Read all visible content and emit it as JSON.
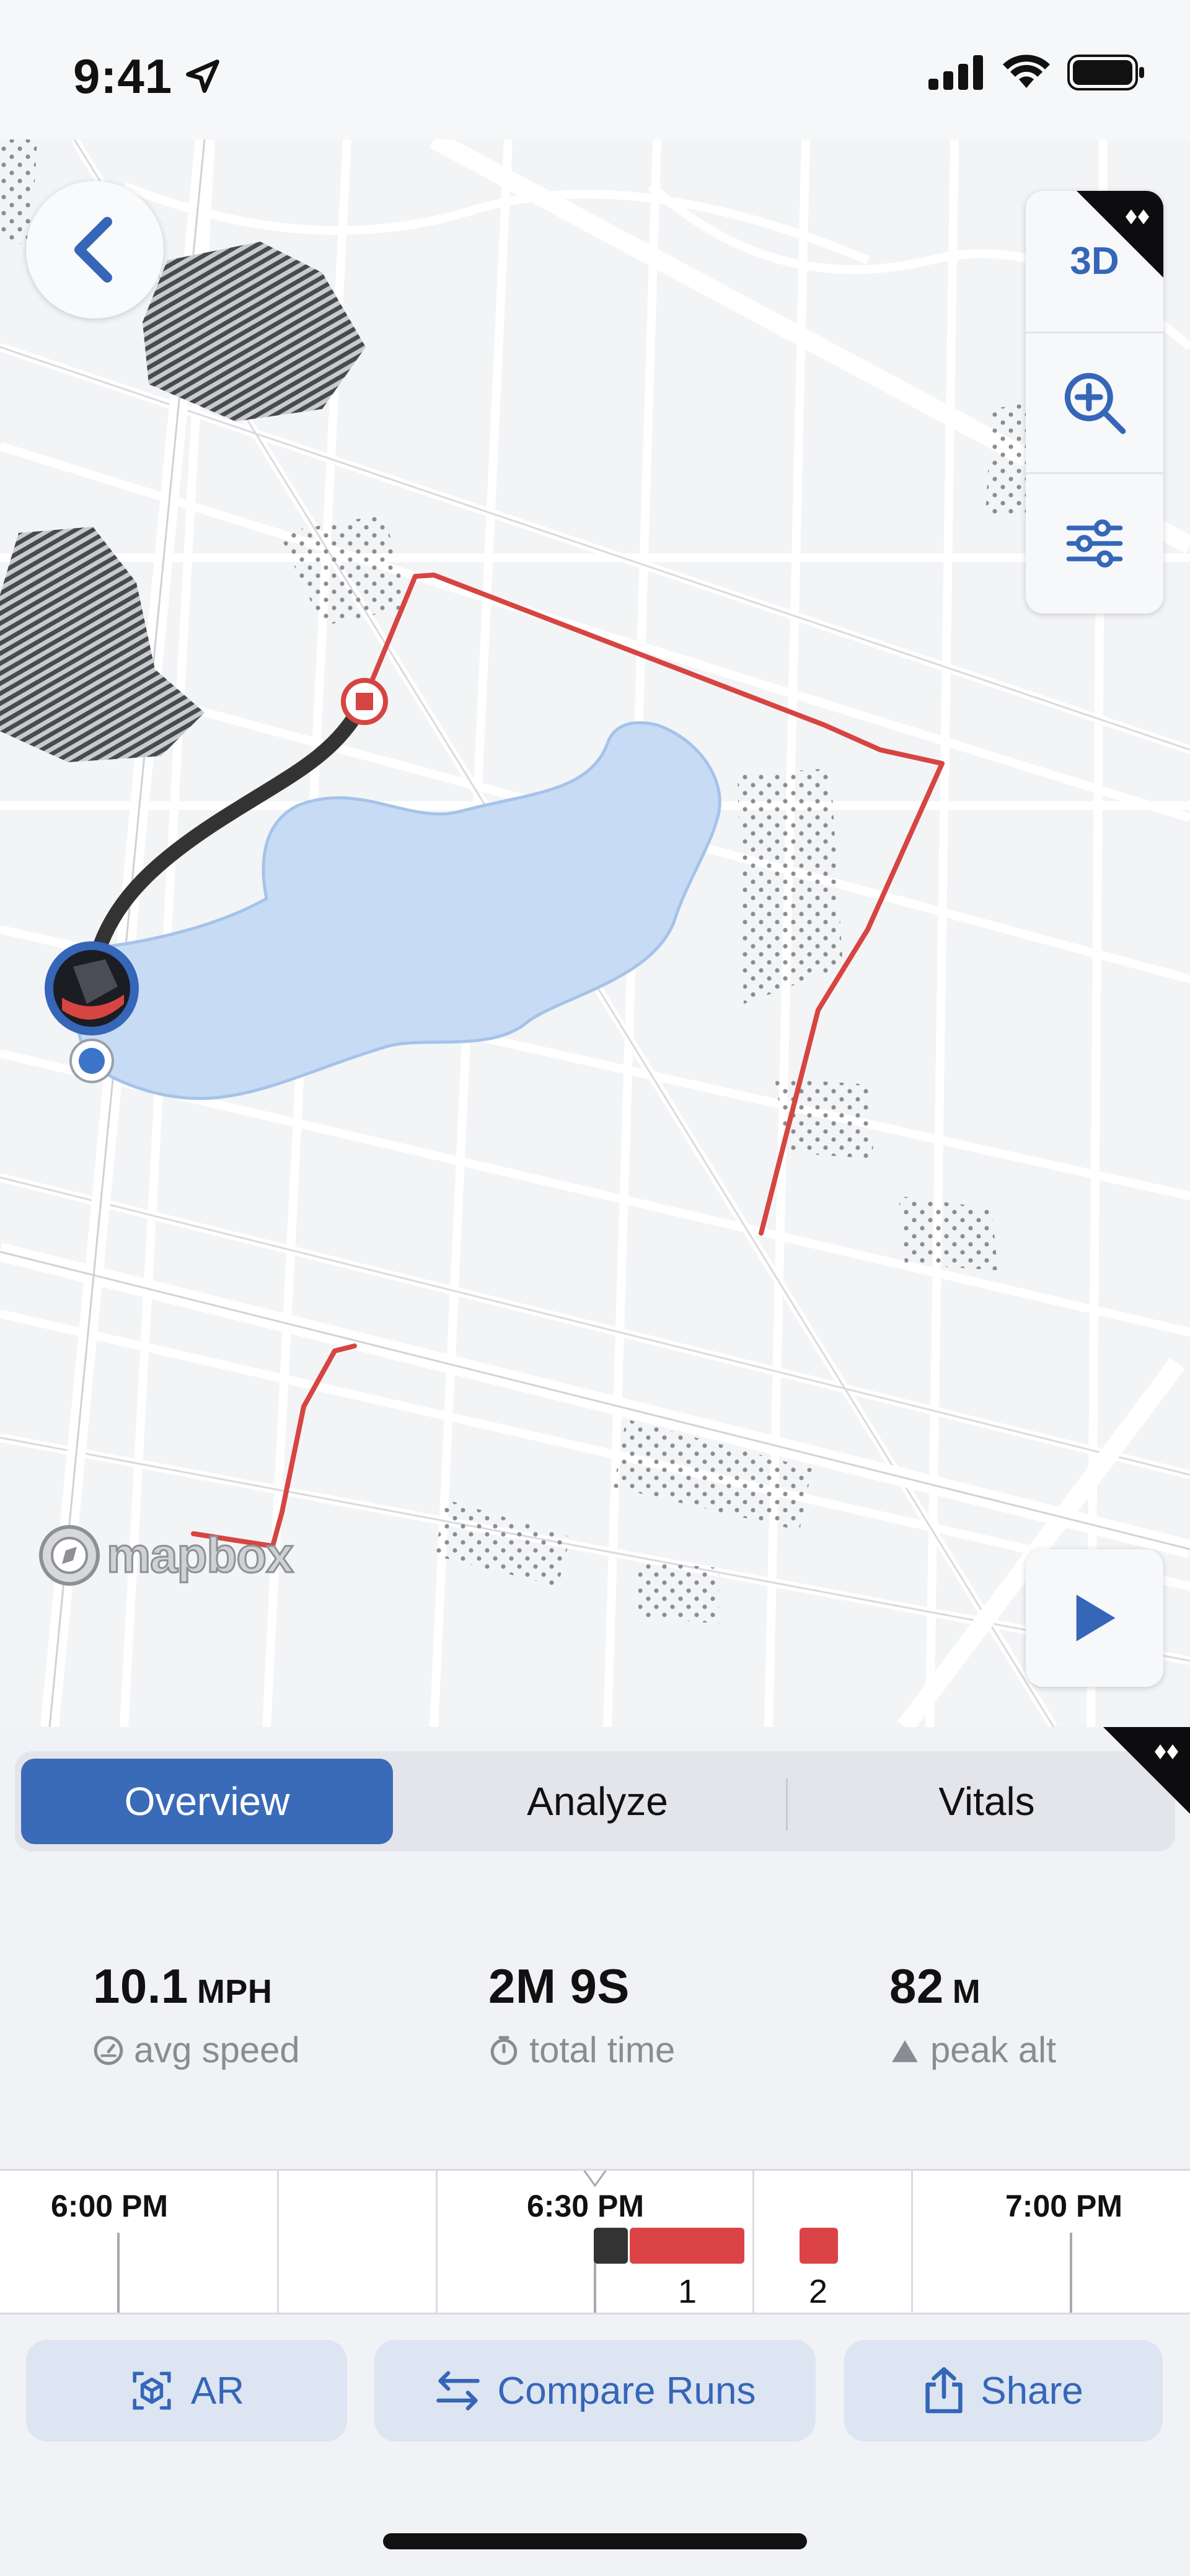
{
  "status_bar": {
    "time": "9:41",
    "icons": [
      "location-arrow-icon",
      "cellular-signal-icon",
      "wifi-icon",
      "battery-icon"
    ]
  },
  "map": {
    "controls": {
      "mode_3d_label": "3D"
    },
    "attribution": "mapbox",
    "icons": [
      "chevron-left-icon",
      "zoom-in-icon",
      "sliders-icon",
      "play-icon"
    ],
    "route_color": "#d64541",
    "recorded_track_color": "#333333",
    "water_color": "#c7dcf4"
  },
  "tabs": {
    "overview": "Overview",
    "analyze": "Analyze",
    "vitals": "Vitals",
    "selected": "Overview"
  },
  "stats": [
    {
      "value": "10.1",
      "unit": "MPH",
      "label": "avg speed",
      "icon": "speedometer-icon"
    },
    {
      "value": "2M 9S",
      "unit": "",
      "label": "total time",
      "icon": "timer-icon"
    },
    {
      "value": "82",
      "unit": "M",
      "label": "peak alt",
      "icon": "mountain-icon"
    }
  ],
  "timeline": {
    "labels": [
      "6:00 PM",
      "6:30 PM",
      "7:00 PM"
    ],
    "segments": [
      "1",
      "2"
    ],
    "segment_color": "#dc4347",
    "idle_color": "#333333"
  },
  "actions": {
    "ar": "AR",
    "compare": "Compare Runs",
    "share": "Share",
    "accent": "#3566b8"
  }
}
